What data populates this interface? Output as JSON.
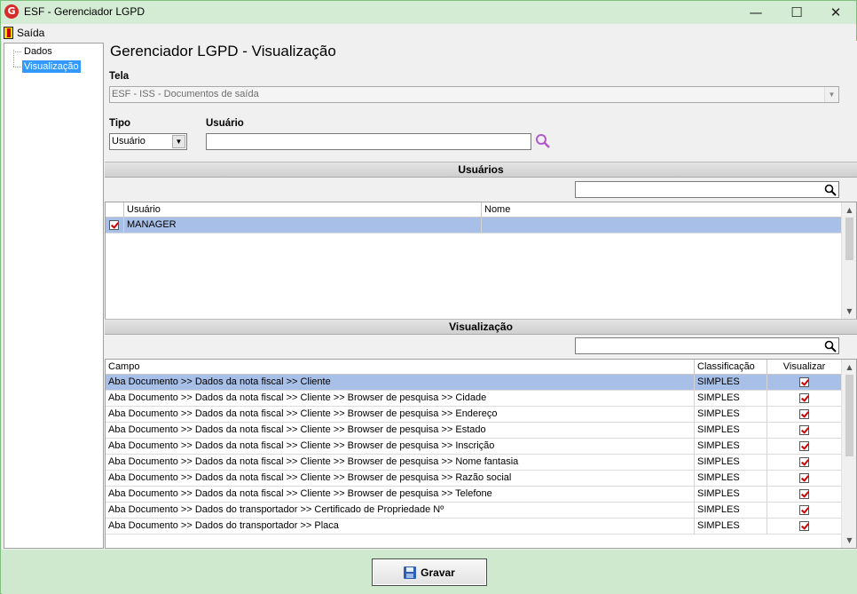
{
  "window": {
    "title": "ESF - Gerenciador LGPD",
    "logo_letter": "G",
    "minimize": "—",
    "maximize": "☐",
    "close": "✕"
  },
  "menu": {
    "exit_label": "Saída"
  },
  "sidebar": {
    "items": [
      {
        "label": "Dados",
        "selected": false
      },
      {
        "label": "Visualização",
        "selected": true
      }
    ]
  },
  "main": {
    "title": "Gerenciador LGPD - Visualização",
    "tela": {
      "label": "Tela",
      "value": "ESF - ISS - Documentos de saída"
    },
    "tipo": {
      "label": "Tipo",
      "value": "Usuário"
    },
    "usuario": {
      "label": "Usuário",
      "value": ""
    }
  },
  "usuarios_section": {
    "header": "Usuários",
    "columns": [
      "Usuário",
      "Nome"
    ],
    "rows": [
      {
        "checked": true,
        "usuario": "MANAGER",
        "nome": "",
        "selected": true
      }
    ]
  },
  "visualizacao_section": {
    "header": "Visualização",
    "columns": [
      "Campo",
      "Classificação",
      "Visualizar"
    ],
    "rows": [
      {
        "campo": "Aba Documento >> Dados da nota fiscal >> Cliente",
        "classificacao": "SIMPLES",
        "visualizar": true,
        "selected": true
      },
      {
        "campo": "Aba Documento >> Dados da nota fiscal >> Cliente >> Browser de pesquisa >> Cidade",
        "classificacao": "SIMPLES",
        "visualizar": true
      },
      {
        "campo": "Aba Documento >> Dados da nota fiscal >> Cliente >> Browser de pesquisa >> Endereço",
        "classificacao": "SIMPLES",
        "visualizar": true
      },
      {
        "campo": "Aba Documento >> Dados da nota fiscal >> Cliente >> Browser de pesquisa >> Estado",
        "classificacao": "SIMPLES",
        "visualizar": true
      },
      {
        "campo": "Aba Documento >> Dados da nota fiscal >> Cliente >> Browser de pesquisa >> Inscrição",
        "classificacao": "SIMPLES",
        "visualizar": true
      },
      {
        "campo": "Aba Documento >> Dados da nota fiscal >> Cliente >> Browser de pesquisa >> Nome fantasia",
        "classificacao": "SIMPLES",
        "visualizar": true
      },
      {
        "campo": "Aba Documento >> Dados da nota fiscal >> Cliente >> Browser de pesquisa >> Razão social",
        "classificacao": "SIMPLES",
        "visualizar": true
      },
      {
        "campo": "Aba Documento >> Dados da nota fiscal >> Cliente >> Browser de pesquisa >> Telefone",
        "classificacao": "SIMPLES",
        "visualizar": true
      },
      {
        "campo": "Aba Documento >> Dados do transportador >> Certificado de Propriedade Nº",
        "classificacao": "SIMPLES",
        "visualizar": true
      },
      {
        "campo": "Aba Documento >> Dados do transportador >> Placa",
        "classificacao": "SIMPLES",
        "visualizar": true
      }
    ]
  },
  "footer": {
    "save_label": "Gravar"
  },
  "colors": {
    "window_frame": "#cfe9cf",
    "selection": "#a8bfe8",
    "tree_selection": "#3399ff",
    "check_mark": "#d00000",
    "search_icon": "#b05cc8"
  }
}
